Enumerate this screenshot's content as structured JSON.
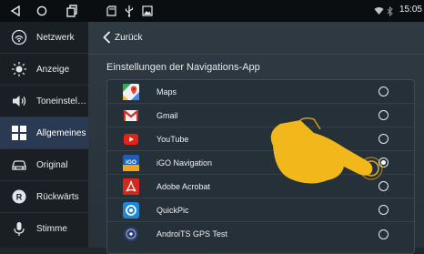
{
  "statusbar": {
    "time": "15:05",
    "nav_icons": [
      "back-triangle-icon",
      "home-circle-icon",
      "recent-apps-icon"
    ],
    "notification_icons": [
      "sd-card-icon",
      "usb-icon",
      "image-icon"
    ]
  },
  "sidebar": {
    "items": [
      {
        "label": "Netzwerk",
        "icon": "network-icon"
      },
      {
        "label": "Anzeige",
        "icon": "brightness-icon"
      },
      {
        "label": "Toneinstellungen",
        "icon": "speaker-icon"
      },
      {
        "label": "Allgemeines",
        "icon": "grid-icon",
        "active": true
      },
      {
        "label": "Original",
        "icon": "car-icon"
      },
      {
        "label": "Rückwärts",
        "icon": "reverse-icon"
      },
      {
        "label": "Stimme",
        "icon": "microphone-icon"
      }
    ]
  },
  "main": {
    "back_label": "Zurück",
    "section_title": "Einstellungen der Navigations-App",
    "apps": [
      {
        "name": "Maps",
        "icon": "google-maps-icon",
        "selected": false
      },
      {
        "name": "Gmail",
        "icon": "gmail-icon",
        "selected": false
      },
      {
        "name": "YouTube",
        "icon": "youtube-icon",
        "selected": false
      },
      {
        "name": "iGO Navigation",
        "icon": "igo-icon",
        "selected": true
      },
      {
        "name": "Adobe Acrobat",
        "icon": "acrobat-icon",
        "selected": false
      },
      {
        "name": "QuickPic",
        "icon": "quickpic-icon",
        "selected": false
      },
      {
        "name": "AndroiTS GPS Test",
        "icon": "gps-test-icon",
        "selected": false
      }
    ]
  },
  "colors": {
    "sidebar_active": "#2a3a52",
    "hand": "#f2b81b"
  }
}
